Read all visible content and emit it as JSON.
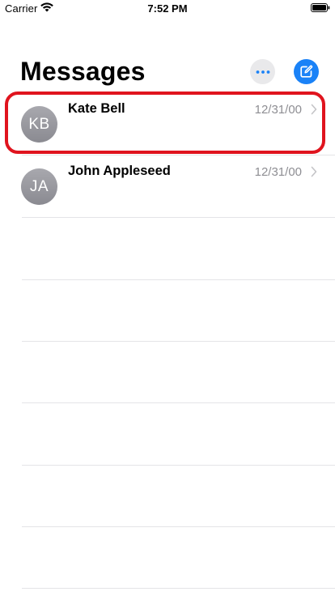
{
  "status_bar": {
    "carrier": "Carrier",
    "time": "7:52 PM"
  },
  "header": {
    "title": "Messages",
    "more_icon": "ellipsis-icon",
    "compose_icon": "compose-icon"
  },
  "conversations": [
    {
      "initials": "KB",
      "name": "Kate Bell",
      "date": "12/31/00"
    },
    {
      "initials": "JA",
      "name": "John Appleseed",
      "date": "12/31/00"
    }
  ],
  "colors": {
    "accent": "#1a82f7",
    "secondary_text": "#8e8e93",
    "highlight": "#e0141e"
  }
}
